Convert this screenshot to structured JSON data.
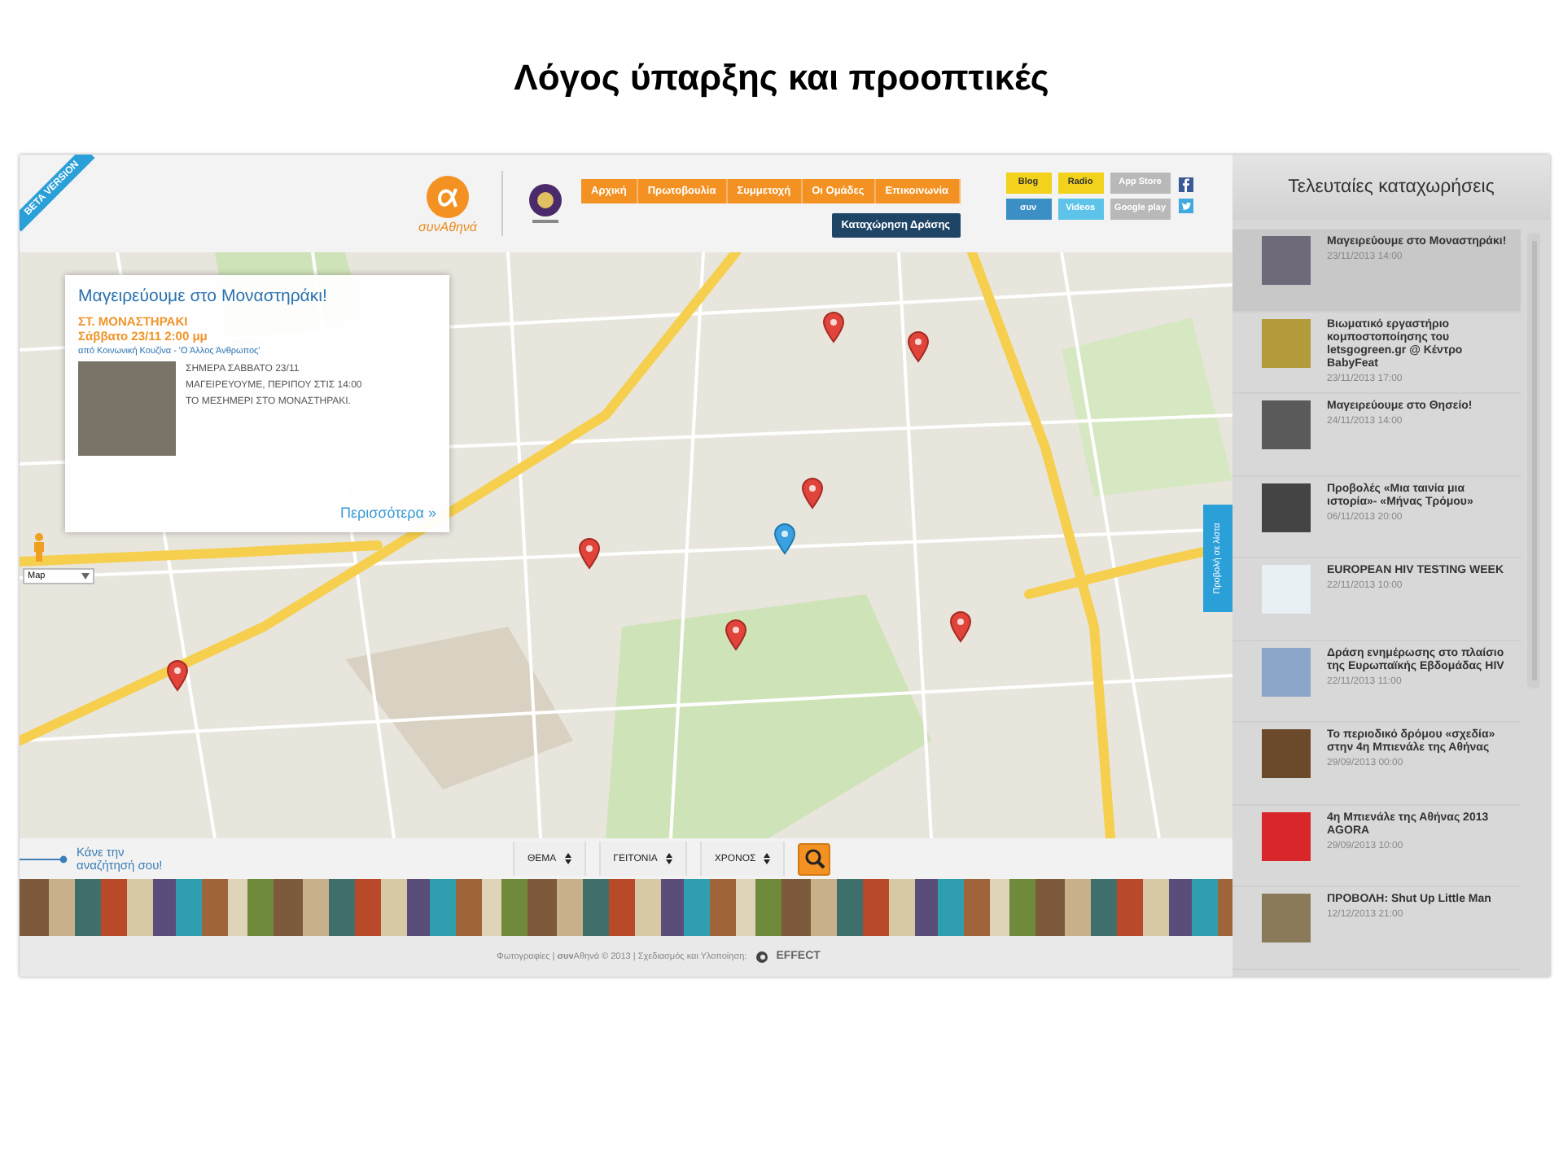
{
  "slide": {
    "title": "Λόγος ύπαρξης και προοπτικές"
  },
  "site": {
    "beta_ribbon": "BETA VERSION",
    "logo_text": "συνΑθηνά",
    "nav": [
      {
        "label": "Αρχική"
      },
      {
        "label": "Πρωτοβουλία"
      },
      {
        "label": "Συμμετοχή"
      },
      {
        "label": "Οι Ομάδες"
      },
      {
        "label": "Επικοινωνία"
      }
    ],
    "action_button": "Καταχώρηση Δράσης",
    "badges": [
      {
        "label": "Blog",
        "color": "#f2d21b"
      },
      {
        "label": "Radio",
        "color": "#f2d21b"
      },
      {
        "label": "App Store",
        "color": "#b9b9b9"
      },
      {
        "label": "συν",
        "color": "#3b8fc4"
      },
      {
        "label": "Videos",
        "color": "#5ec3e8"
      },
      {
        "label": "Google play",
        "color": "#b9b9b9"
      }
    ],
    "popup": {
      "title": "Μαγειρεύουμε στο Μοναστηράκι!",
      "place": "ΣΤ. ΜΟΝΑΣΤΗΡΑΚΙ",
      "date": "Σάββατο 23/11 2:00 μμ",
      "organizer": "από Κοινωνική Κουζίνα - 'Ο Άλλος Άνθρωπος'",
      "description": "ΣΗΜΕΡΑ ΣΑΒΒΑΤΟ 23/11 ΜΑΓΕΙΡΕΥΟΥΜΕ, ΠΕΡΙΠΟΥ ΣΤΙΣ 14:00 ΤΟ ΜΕΣΗΜΕΡΙ ΣΤΟ ΜΟΝΑΣΤΗΡΑΚΙ.",
      "more": "Περισσότερα »"
    },
    "map_type": "Map",
    "list_view_tab": "Προβολή σε λίστα",
    "search": {
      "prompt": "Κάνε την αναζήτησή σου!",
      "filters": [
        "ΘΕΜΑ",
        "ΓΕΙΤΟΝΙΑ",
        "ΧΡΟΝΟΣ"
      ]
    },
    "footer": {
      "text": "Φωτογραφίες | **συν**Αθηνά © 2013 | Σχεδιασμός και Υλοποίηση:",
      "brand": "EFFECT"
    },
    "sidebar": {
      "title": "Τελευταίες καταχωρήσεις",
      "items": [
        {
          "title": "Μαγειρεύουμε στο Μοναστηράκι!",
          "date": "23/11/2013 14:00",
          "selected": true
        },
        {
          "title": "Βιωματικό εργαστήριο κομποστοποίησης του letsgogreen.gr @ Κέντρο BabyFeat",
          "date": "23/11/2013 17:00",
          "selected": false
        },
        {
          "title": "Μαγειρεύουμε στο Θησείο!",
          "date": "24/11/2013 14:00",
          "selected": false
        },
        {
          "title": "Προβολές «Μια ταινία μια ιστορία»- «Μήνας Τρόμου»",
          "date": "06/11/2013 20:00",
          "selected": false
        },
        {
          "title": "EUROPEAN HIV TESTING WEEK",
          "date": "22/11/2013 10:00",
          "selected": false
        },
        {
          "title": "Δράση ενημέρωσης στο πλαίσιο της Ευρωπαϊκής Εβδομάδας HIV",
          "date": "22/11/2013 11:00",
          "selected": false
        },
        {
          "title": "Το περιοδικό δρόμου «σχεδία» στην 4η Μπιενάλε της Αθήνας",
          "date": "29/09/2013 00:00",
          "selected": false
        },
        {
          "title": "4η Μπιενάλε της Αθήνας 2013 AGORA",
          "date": "29/09/2013 10:00",
          "selected": false
        },
        {
          "title": "ΠΡΟΒΟΛΗ: Shut Up Little Man",
          "date": "12/12/2013 21:00",
          "selected": false
        }
      ]
    }
  }
}
